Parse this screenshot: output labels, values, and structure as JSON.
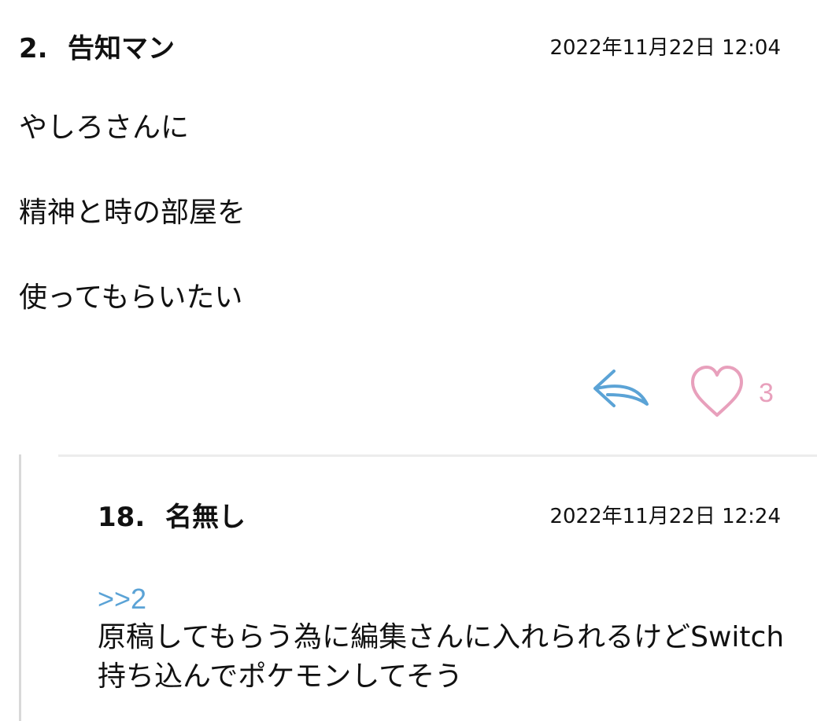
{
  "post": {
    "number": "2.",
    "author": "告知マン",
    "timestamp": "2022年11月22日 12:04",
    "lines": [
      "やしろさんに",
      "精神と時の部屋を",
      "使ってもらいたい"
    ],
    "actions": {
      "reply_icon": "reply-arrow-icon",
      "like_icon": "heart-outline-icon",
      "like_count": "3",
      "reply_color": "#5ba3d6",
      "like_color": "#e8a0bc"
    }
  },
  "reply": {
    "number": "18.",
    "author": "名無し",
    "timestamp": "2022年11月22日 12:24",
    "anchor": ">>2",
    "text": "原稿してもらう為に編集さんに入れられるけどSwitch持ち込んでポケモンしてそう"
  }
}
